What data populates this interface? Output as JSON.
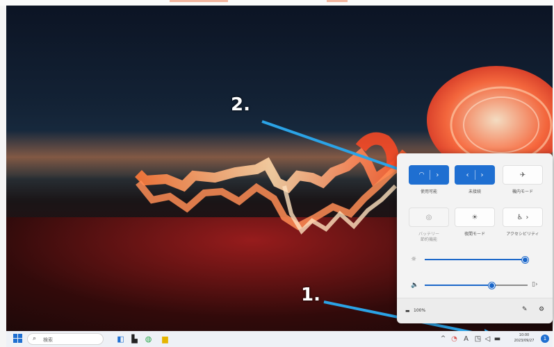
{
  "annotations": {
    "step1": "1.",
    "step2": "2."
  },
  "quick_settings": {
    "tiles": [
      {
        "name": "wifi",
        "label": "使用可能",
        "state": "on",
        "icon": "wifi-icon",
        "chevron": "›"
      },
      {
        "name": "bluetooth",
        "label": "未接続",
        "state": "on",
        "icon": "bluetooth-icon",
        "chevron": "›"
      },
      {
        "name": "airplane",
        "label": "機内モード",
        "state": "off",
        "icon": "airplane-icon"
      },
      {
        "name": "battery-saver",
        "label": "バッテリー\n節約機能",
        "state": "disabled",
        "icon": "battery-saver-icon"
      },
      {
        "name": "night-light",
        "label": "夜間モード",
        "state": "off",
        "icon": "night-light-icon"
      },
      {
        "name": "accessibility",
        "label": "アクセシビリティ",
        "state": "off",
        "icon": "accessibility-icon",
        "chevron": "›"
      }
    ],
    "brightness": 0.97,
    "volume": 0.65,
    "battery": "100%"
  },
  "taskbar": {
    "search_placeholder": "検索",
    "clock_time": "10:00",
    "clock_date": "2023/09/27",
    "tray_letter": "A",
    "notification_count": "1"
  },
  "colors": {
    "accent": "#1f6fd1",
    "arrow": "#2ba3e6"
  }
}
